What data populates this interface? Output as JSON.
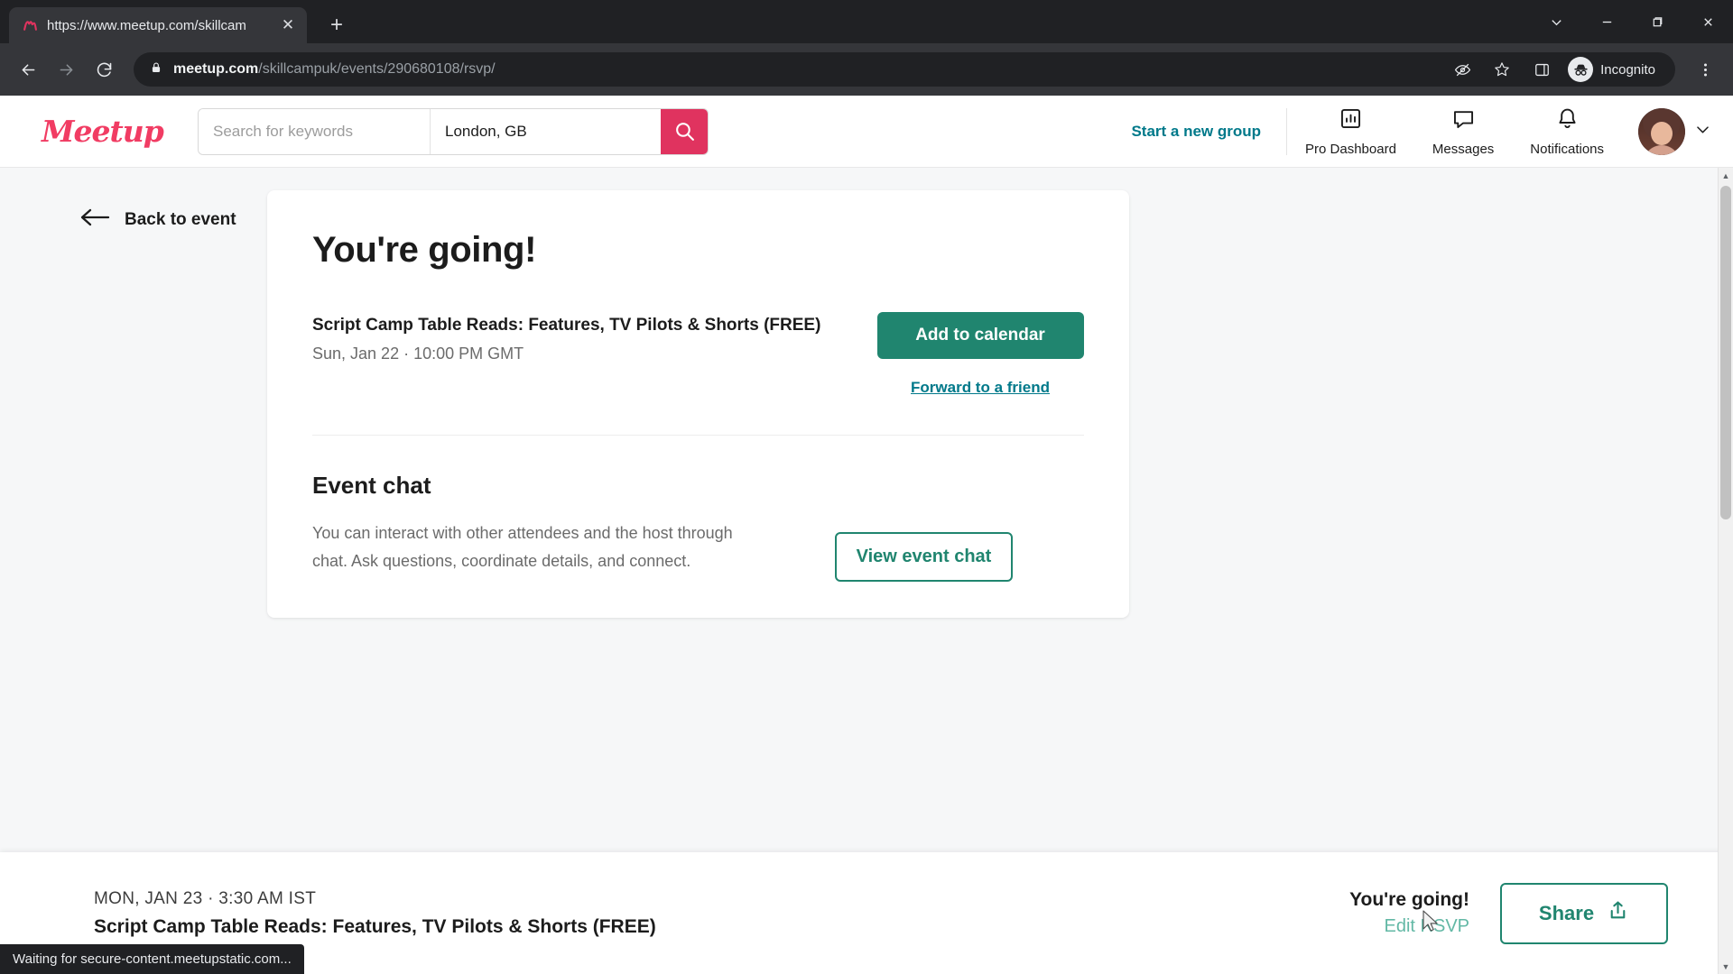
{
  "browser": {
    "tab": {
      "title": "https://www.meetup.com/skillcam",
      "favicon_icon": "meetup-favicon",
      "close_icon": "close-icon"
    },
    "new_tab_icon": "plus-icon",
    "window_controls": [
      {
        "name": "chevron-down-icon",
        "glyph": "v"
      },
      {
        "name": "minimize-icon",
        "glyph": "—"
      },
      {
        "name": "restore-icon",
        "glyph": "❐"
      },
      {
        "name": "close-icon",
        "glyph": "✕"
      }
    ],
    "nav": {
      "back_icon": "back-arrow-icon",
      "forward_icon": "forward-arrow-icon",
      "reload_icon": "reload-icon"
    },
    "omnibox": {
      "lock_icon": "lock-icon",
      "url_domain": "meetup.com",
      "url_path": "/skillcampuk/events/290680108/rsvp/",
      "tracking_icon": "eye-crossed-icon",
      "bookmark_icon": "star-icon",
      "sidepanel_icon": "side-panel-icon",
      "incognito_label": "Incognito",
      "incognito_icon": "incognito-icon",
      "menu_icon": "three-dot-menu-icon"
    },
    "status_bubble": "Waiting for secure-content.meetupstatic.com..."
  },
  "site_header": {
    "logo_text": "Meetup",
    "search": {
      "keyword_placeholder": "Search for keywords",
      "keyword_value": "",
      "location_value": "London, GB",
      "search_icon": "search-icon"
    },
    "start_group_label": "Start a new group",
    "nav_items": [
      {
        "label": "Pro Dashboard",
        "icon": "bar-chart-icon"
      },
      {
        "label": "Messages",
        "icon": "chat-bubble-icon"
      },
      {
        "label": "Notifications",
        "icon": "bell-icon"
      }
    ],
    "avatar_icon": "user-avatar",
    "avatar_chevron_icon": "chevron-down-icon"
  },
  "main": {
    "back_link": {
      "label": "Back to event",
      "icon": "arrow-left-icon"
    },
    "heading": "You're going!",
    "event": {
      "title": "Script Camp Table Reads: Features, TV Pilots & Shorts (FREE)",
      "datetime": "Sun, Jan 22 · 10:00 PM GMT",
      "add_to_calendar_label": "Add to calendar",
      "forward_label": "Forward to a friend"
    },
    "chat": {
      "heading": "Event chat",
      "description": "You can interact with other attendees and the host through chat. Ask questions, coordinate details, and connect.",
      "view_button_label": "View event chat"
    }
  },
  "bottom_bar": {
    "date": "MON, JAN 23 · 3:30 AM IST",
    "title": "Script Camp Table Reads: Features, TV Pilots & Shorts (FREE)",
    "status_label": "You're going!",
    "edit_label": "Edit RSVP",
    "share_label": "Share",
    "share_icon": "share-icon"
  },
  "colors": {
    "brand_red": "#e0335f",
    "teal": "#00798a",
    "green": "#20856f",
    "mint": "#62b8a5"
  }
}
